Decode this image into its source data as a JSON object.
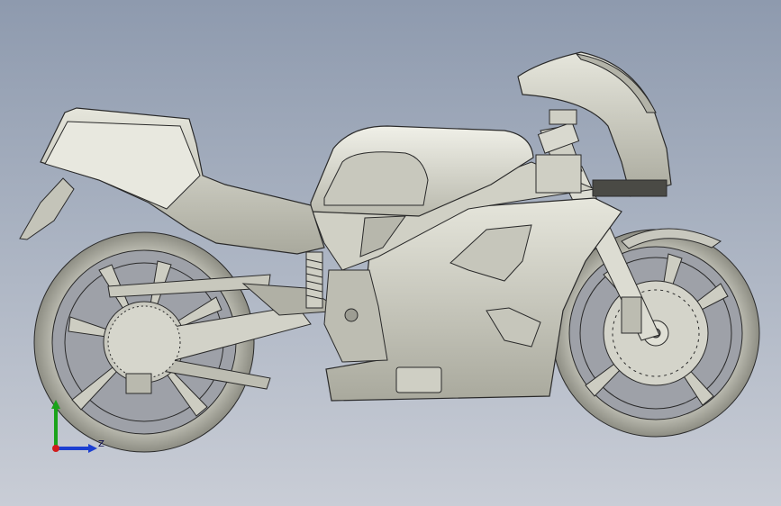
{
  "viewport": {
    "background_top": "#8e9aae",
    "background_bottom": "#c9cdd6",
    "model_fill": "#d9d9cf",
    "model_edge": "#2a2a2a"
  },
  "triad": {
    "x_label": "",
    "y_label": "",
    "z_label": "Z",
    "colors": {
      "x": "#d11c1c",
      "y": "#1aa31a",
      "z": "#1c3fd1"
    }
  }
}
